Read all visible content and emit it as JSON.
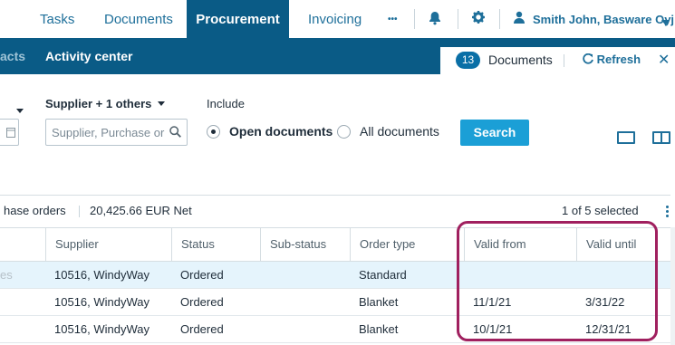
{
  "nav": {
    "tabs": [
      "Tasks",
      "Documents",
      "Procurement",
      "Invoicing"
    ],
    "active_tab": "Procurement",
    "more": "•••",
    "user": "Smith John, Basware Oyj"
  },
  "subnav": {
    "partial_link": "acts",
    "activity_center": "Activity center"
  },
  "doc_panel": {
    "count": "13",
    "label": "Documents",
    "refresh": "Refresh",
    "close": "✕"
  },
  "filters": {
    "supplier_label": "Supplier + 1 others",
    "supplier_placeholder": "Supplier, Purchase or",
    "include_label": "Include",
    "open_documents": "Open documents",
    "all_documents": "All documents",
    "selected_include": "open",
    "search_button": "Search"
  },
  "summary": {
    "partial_orders": "hase orders",
    "net_total": "20,425.66 EUR Net",
    "selected": "1 of 5 selected"
  },
  "table": {
    "columns": [
      "Supplier",
      "Status",
      "Sub-status",
      "Order type",
      "Valid from",
      "Valid until"
    ],
    "rows": [
      {
        "lead": "es",
        "supplier": "10516, WindyWay",
        "status": "Ordered",
        "sub_status": "",
        "order_type": "Standard",
        "valid_from": "",
        "valid_until": "",
        "selected": true
      },
      {
        "lead": "",
        "supplier": "10516, WindyWay",
        "status": "Ordered",
        "sub_status": "",
        "order_type": "Blanket",
        "valid_from": "11/1/21",
        "valid_until": "3/31/22",
        "selected": false
      },
      {
        "lead": "",
        "supplier": "10516, WindyWay",
        "status": "Ordered",
        "sub_status": "",
        "order_type": "Blanket",
        "valid_from": "10/1/21",
        "valid_until": "12/31/21",
        "selected": false
      }
    ]
  },
  "colors": {
    "brand": "#0a5b86",
    "accent": "#1b9fd6",
    "highlight": "#a0205f",
    "selected_row": "#e5f4fc"
  }
}
